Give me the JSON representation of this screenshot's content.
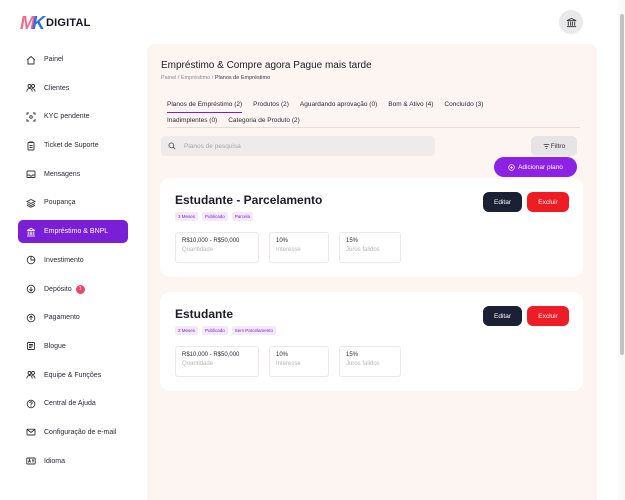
{
  "brand": {
    "mark": "MK",
    "name": "DIGITAL"
  },
  "sidebar": {
    "items": [
      {
        "label": "Painel",
        "icon": "home-icon"
      },
      {
        "label": "Clientes",
        "icon": "users-icon"
      },
      {
        "label": "KYC pendente",
        "icon": "scan-icon"
      },
      {
        "label": "Ticket de Suporte",
        "icon": "clipboard-icon"
      },
      {
        "label": "Mensagens",
        "icon": "inbox-icon"
      },
      {
        "label": "Poupança",
        "icon": "layers-icon"
      },
      {
        "label": "Empréstimo & BNPL",
        "icon": "bank-icon"
      },
      {
        "label": "Investimento",
        "icon": "pie-icon"
      },
      {
        "label": "Depósito",
        "icon": "download-icon",
        "badge": "1"
      },
      {
        "label": "Pagamento",
        "icon": "upload-icon"
      },
      {
        "label": "Blogue",
        "icon": "document-icon"
      },
      {
        "label": "Equipe & Funções",
        "icon": "team-icon"
      },
      {
        "label": "Central de Ajuda",
        "icon": "help-icon"
      },
      {
        "label": "Configuração de e-mail",
        "icon": "mail-icon"
      },
      {
        "label": "Idioma",
        "icon": "language-icon"
      }
    ]
  },
  "page": {
    "title": "Empréstimo & Compre agora Pague mais tarde",
    "breadcrumb": [
      "Painel",
      "Empréstimo",
      "Planos de Empréstimo"
    ]
  },
  "tabs": [
    "Planos de Empréstimo (2)",
    "Produtos (2)",
    "Aguardando aprovação (0)",
    "Bom & Ativo (4)",
    "Concluído (3)",
    "Inadimplentes (0)",
    "Categoria de Produto (2)"
  ],
  "search": {
    "placeholder": "Planos de pesquisa"
  },
  "filter_label": "Filtro",
  "add_label": "Adicionar plano",
  "edit_label": "Editar",
  "delete_label": "Excluir",
  "plans": [
    {
      "title": "Estudante - Parcelamento",
      "tags": [
        "3 Meses",
        "Publicado",
        "Parcela"
      ],
      "stats": [
        {
          "value": "R$10,000 - R$50,000",
          "label": "Quantidade"
        },
        {
          "value": "10%",
          "label": "Interesse"
        },
        {
          "value": "15%",
          "label": "Juros falidos"
        }
      ]
    },
    {
      "title": "Estudante",
      "tags": [
        "2 Meses",
        "Publicado",
        "Sem Parcelamento"
      ],
      "stats": [
        {
          "value": "R$10,000 - R$50,000",
          "label": "Quantidade"
        },
        {
          "value": "10%",
          "label": "Interesse"
        },
        {
          "value": "15%",
          "label": "Juros falidos"
        }
      ]
    }
  ],
  "colors": {
    "accent": "#7b1fd6",
    "danger": "#ee1c25",
    "dark": "#1b2034",
    "panel": "#fdf5f1"
  }
}
